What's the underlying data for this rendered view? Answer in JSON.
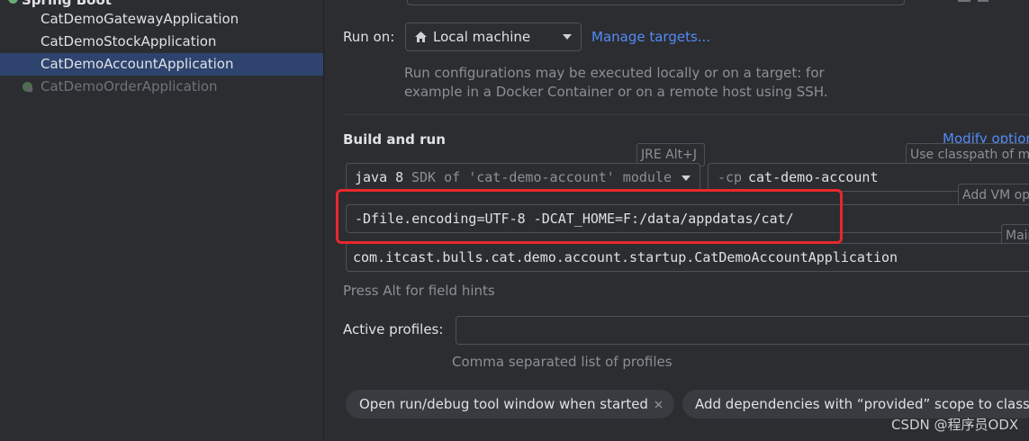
{
  "tree": {
    "group_label": "Spring Boot",
    "items": [
      {
        "label": "CatDemoGatewayApplication",
        "state": "normal"
      },
      {
        "label": "CatDemoStockApplication",
        "state": "normal"
      },
      {
        "label": "CatDemoAccountApplication",
        "state": "selected"
      },
      {
        "label": "CatDemoOrderApplication",
        "state": "disabled"
      }
    ]
  },
  "run_on": {
    "label": "Run on:",
    "value": "Local machine",
    "manage_link": "Manage targets...",
    "description_line1": "Run configurations may be executed locally or on a target: for",
    "description_line2": "example in a Docker Container or on a remote host using SSH."
  },
  "build_and_run": {
    "heading": "Build and run",
    "modify_options": "Modify options",
    "jre_hint": "JRE Alt+J",
    "classpath_hint": "Use classpath of module",
    "vm_hint": "Add VM options",
    "main_hint": "Main class",
    "sdk_java": "java 8",
    "sdk_desc": "SDK of 'cat-demo-account' module",
    "cp_flag": "-cp",
    "cp_module": "cat-demo-account",
    "vm_options": "-Dfile.encoding=UTF-8 -DCAT_HOME=F:/data/appdatas/cat/",
    "main_class": "com.itcast.bulls.cat.demo.account.startup.CatDemoAccountApplication",
    "field_hint": "Press Alt for field hints"
  },
  "profiles": {
    "label": "Active profiles:",
    "value": "",
    "help": "Comma separated list of profiles"
  },
  "chips": [
    {
      "label": "Open run/debug tool window when started"
    },
    {
      "label": "Add dependencies with “provided” scope to classpath"
    }
  ],
  "watermark": "CSDN @程序员ODX",
  "colors": {
    "accent": "#548af7",
    "selection": "#2e436e",
    "highlight_box": "#e8282c"
  }
}
